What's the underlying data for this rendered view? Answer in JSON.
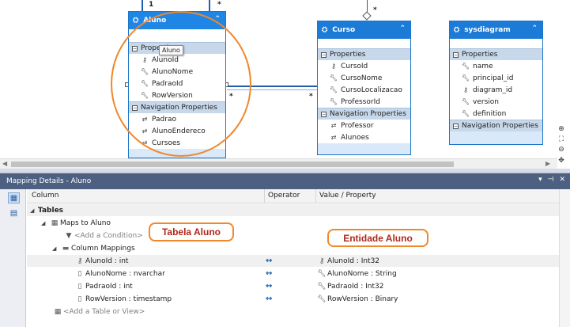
{
  "designer": {
    "entities": {
      "aluno": {
        "title": "Aluno",
        "properties_header": "Properties",
        "properties": [
          "AlunoId",
          "AlunoNome",
          "PadraoId",
          "RowVersion"
        ],
        "nav_header": "Navigation Properties",
        "navigation": [
          "Padrao",
          "AlunoEndereco",
          "Cursoes"
        ]
      },
      "curso": {
        "title": "Curso",
        "properties_header": "Properties",
        "properties": [
          "CursoId",
          "CursoNome",
          "CursoLocalizacao",
          "ProfessorId"
        ],
        "nav_header": "Navigation Properties",
        "navigation": [
          "Professor",
          "Alunoes"
        ]
      },
      "sysdiagram": {
        "title": "sysdiagram",
        "properties_header": "Properties",
        "properties": [
          "name",
          "principal_id",
          "diagram_id",
          "version",
          "definition"
        ],
        "nav_header": "Navigation Properties"
      }
    },
    "tooltip": "Aluno",
    "multiplicities": {
      "top_left": "1",
      "top_right": "*",
      "curso_top": "*",
      "link_left": "*",
      "link_right": "*"
    }
  },
  "mapping": {
    "title": "Mapping Details - Aluno",
    "columns": {
      "column": "Column",
      "operator": "Operator",
      "value": "Value / Property"
    },
    "tables_label": "Tables",
    "maps_to": "Maps to Aluno",
    "add_condition": "<Add a Condition>",
    "column_mappings": "Column Mappings",
    "rows": [
      {
        "column": "AlunoId : int",
        "operator": "↔",
        "value": "AlunoId : Int32"
      },
      {
        "column": "AlunoNome : nvarchar",
        "operator": "↔",
        "value": "AlunoNome : String"
      },
      {
        "column": "PadraoId : int",
        "operator": "↔",
        "value": "PadraoId : Int32"
      },
      {
        "column": "RowVersion : timestamp",
        "operator": "↔",
        "value": "RowVersion : Binary"
      }
    ],
    "add_table": "<Add a Table or View>",
    "callouts": {
      "table": "Tabela Aluno",
      "entity": "Entidade Aluno"
    }
  },
  "colors": {
    "entity_header": "#1c7bd6",
    "panel_title": "#4d6082",
    "annotation": "#f0882c"
  }
}
